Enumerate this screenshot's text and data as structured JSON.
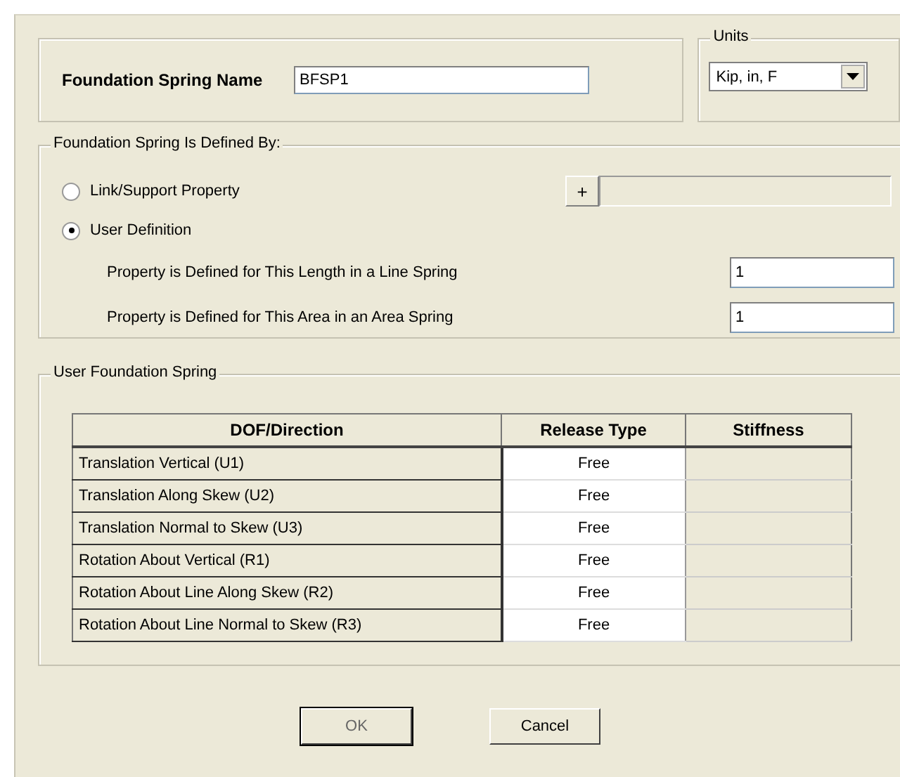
{
  "name_field": {
    "label": "Foundation Spring Name",
    "value": "BFSP1"
  },
  "units": {
    "title": "Units",
    "value": "Kip, in, F"
  },
  "defined_by": {
    "title": "Foundation Spring Is Defined By:",
    "options": [
      {
        "label": "Link/Support Property",
        "selected": false
      },
      {
        "label": "User Definition",
        "selected": true
      }
    ],
    "add_button": "+",
    "fields": [
      {
        "label": "Property is Defined for This Length in a Line Spring",
        "value": "1"
      },
      {
        "label": "Property is Defined for This Area in an Area Spring",
        "value": "1"
      }
    ]
  },
  "user_spring": {
    "title": "User Foundation Spring",
    "columns": [
      "DOF/Direction",
      "Release Type",
      "Stiffness"
    ],
    "rows": [
      {
        "dof": "Translation Vertical (U1)",
        "release": "Free",
        "stiffness_disabled": true
      },
      {
        "dof": "Translation Along Skew (U2)",
        "release": "Free",
        "stiffness_disabled": true
      },
      {
        "dof": "Translation Normal to Skew (U3)",
        "release": "Free",
        "stiffness_disabled": true
      },
      {
        "dof": "Rotation About Vertical (R1)",
        "release": "Free",
        "stiffness_disabled": true
      },
      {
        "dof": "Rotation About Line Along Skew (R2)",
        "release": "Free",
        "stiffness_disabled": true
      },
      {
        "dof": "Rotation About Line Normal to Skew (R3)",
        "release": "Free",
        "stiffness_disabled": true
      }
    ]
  },
  "buttons": [
    "OK",
    "Cancel"
  ]
}
